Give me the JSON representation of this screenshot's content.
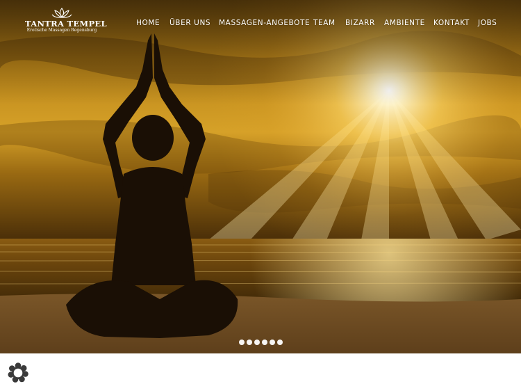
{
  "brand": {
    "title": "TANTRA TEMPEL",
    "subtitle": "Erotische Massagen Regensburg",
    "logo_icon": "lotus-icon"
  },
  "nav": {
    "items": [
      {
        "label": "HOME"
      },
      {
        "label": "ÜBER UNS"
      },
      {
        "label": "MASSAGEN-ANGEBOTE"
      },
      {
        "label": "TEAM"
      },
      {
        "label": "BIZARR"
      },
      {
        "label": "AMBIENTE"
      },
      {
        "label": "KONTAKT"
      },
      {
        "label": "JOBS"
      }
    ]
  },
  "hero": {
    "image": "meditating-woman-at-sunset-sea",
    "slides_total": 6,
    "active_slide": 1
  },
  "floating": {
    "icon": "flower-settings-icon"
  },
  "colors": {
    "nav_text": "#ffffff",
    "sky_gold": "#d9a11f",
    "sky_dark": "#3b2406",
    "sea": "#5a3a0c"
  }
}
